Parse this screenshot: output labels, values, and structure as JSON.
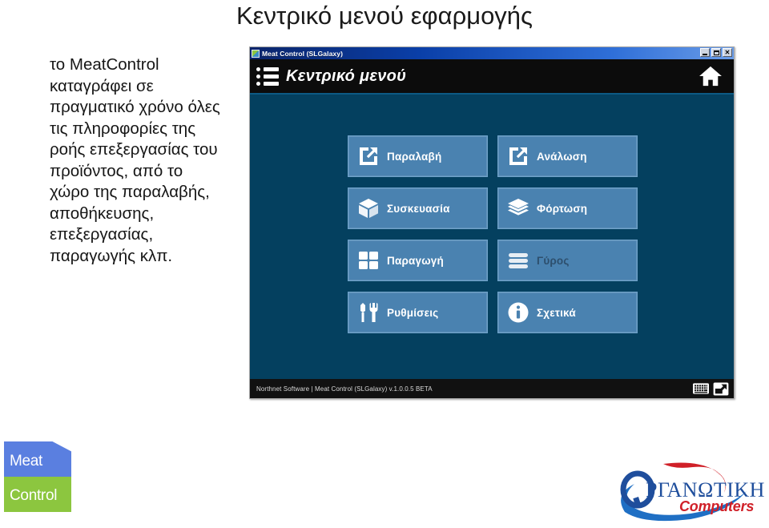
{
  "slide": {
    "title": "Κεντρικό μενού εφαρμογής",
    "body_text": "το MeatControl καταγράφει σε πραγματικό χρόνο όλες τις πληροφορίες της ροής επεξεργασίας του προϊόντος, από το χώρο της παραλαβής, αποθήκευσης, επεξεργασίας, παραγωγής κλπ."
  },
  "window": {
    "titlebar": {
      "title": "Meat Control (SLGalaxy)",
      "app_icon": "app-icon",
      "minimize_label": "_",
      "restore_label": "□",
      "close_label": "✕"
    },
    "header": {
      "title": "Κεντρικό μενού",
      "list_icon": "list-icon",
      "home_icon": "home-icon"
    },
    "menu_buttons": [
      {
        "label": "Παραλαβή",
        "icon": "receive-square-arrow-in-icon",
        "enabled": true
      },
      {
        "label": "Ανάλωση",
        "icon": "consume-square-arrow-out-icon",
        "enabled": true
      },
      {
        "label": "Συσκευασία",
        "icon": "package-box-icon",
        "enabled": true
      },
      {
        "label": "Φόρτωση",
        "icon": "layers-stack-icon",
        "enabled": true
      },
      {
        "label": "Παραγωγή",
        "icon": "grid-four-squares-icon",
        "enabled": true
      },
      {
        "label": "Γύρος",
        "icon": "list-bars-icon",
        "enabled": false
      },
      {
        "label": "Ρυθμίσεις",
        "icon": "screwdriver-wrench-icon",
        "enabled": true
      },
      {
        "label": "Σχετικά",
        "icon": "info-circle-icon",
        "enabled": true
      }
    ],
    "statusbar": {
      "text": "Northnet Software | Meat Control (SLGalaxy) v.1.0.0.5 BETA",
      "keyboard_icon": "keyboard-icon",
      "maximize_icon": "maximize-window-icon"
    }
  },
  "logos": {
    "meat_control": {
      "line1": "Meat",
      "line2": "Control"
    },
    "organotiki": {
      "name": "ΡΓΑΝΩΤΙΚΗ",
      "tagline": "Computers"
    }
  },
  "colors": {
    "window_bg": "#04405f",
    "button_fill": "#4a82b0",
    "header_band": "#0c0c0c",
    "accent_blue": "#0d5a84",
    "logo_blue": "#5a7fe0",
    "logo_green": "#8cc63f",
    "org_blue": "#1f4e9c",
    "org_red": "#d02028"
  }
}
